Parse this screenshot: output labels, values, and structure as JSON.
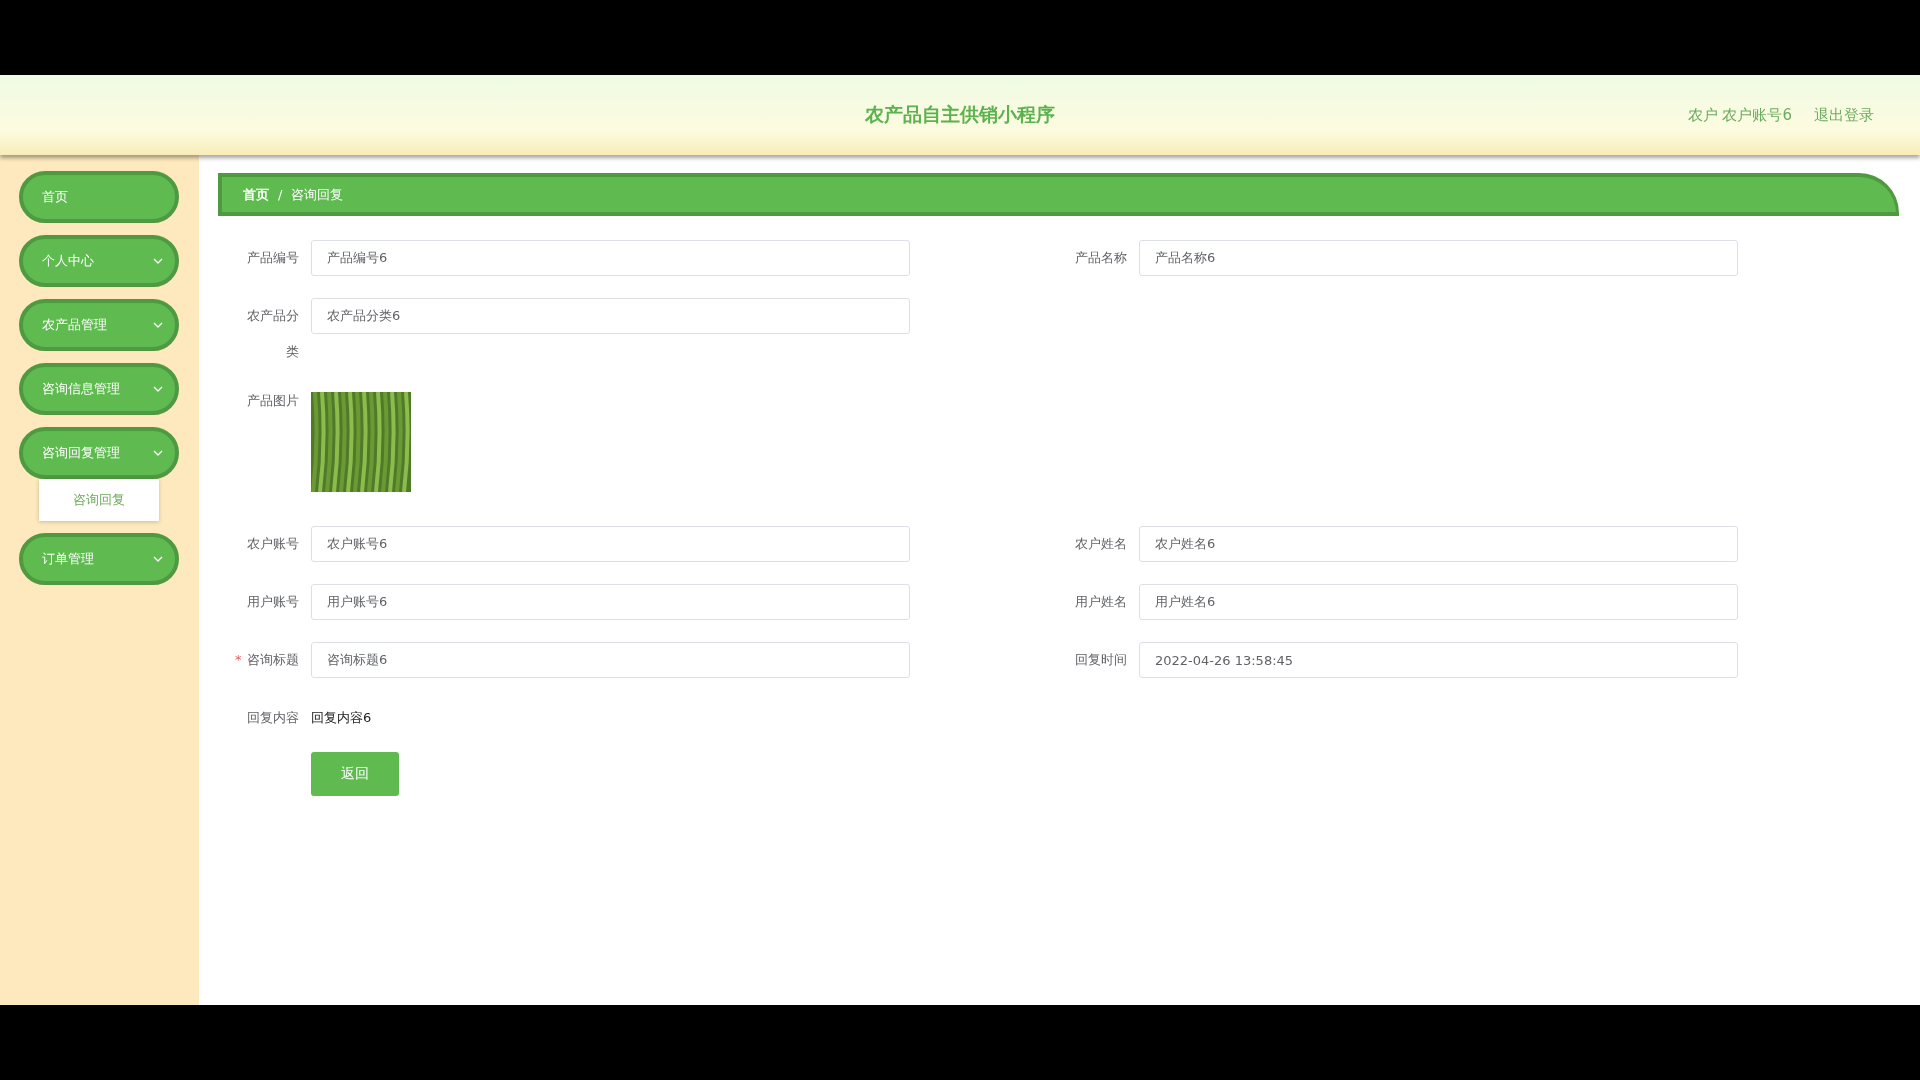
{
  "header": {
    "title": "农产品自主供销小程序",
    "user": "农户 农户账号6",
    "logout": "退出登录"
  },
  "sidebar": {
    "items": [
      {
        "label": "首页",
        "has_submenu": false
      },
      {
        "label": "个人中心",
        "has_submenu": true
      },
      {
        "label": "农产品管理",
        "has_submenu": true
      },
      {
        "label": "咨询信息管理",
        "has_submenu": true
      },
      {
        "label": "咨询回复管理",
        "has_submenu": true,
        "expanded": true,
        "children": [
          {
            "label": "咨询回复"
          }
        ]
      },
      {
        "label": "订单管理",
        "has_submenu": true
      }
    ]
  },
  "breadcrumb": {
    "separator": "/",
    "items": [
      {
        "label": "首页"
      },
      {
        "label": "咨询回复"
      }
    ]
  },
  "form": {
    "rows": [
      [
        {
          "kind": "input",
          "label": "产品编号",
          "value": "产品编号6"
        },
        {
          "kind": "input",
          "label": "产品名称",
          "value": "产品名称6"
        }
      ],
      [
        {
          "kind": "input",
          "label": "农产品分类",
          "value": "农产品分类6"
        }
      ],
      [
        {
          "kind": "image",
          "label": "产品图片"
        }
      ],
      [
        {
          "kind": "input",
          "label": "农户账号",
          "value": "农户账号6"
        },
        {
          "kind": "input",
          "label": "农户姓名",
          "value": "农户姓名6"
        }
      ],
      [
        {
          "kind": "input",
          "label": "用户账号",
          "value": "用户账号6"
        },
        {
          "kind": "input",
          "label": "用户姓名",
          "value": "用户姓名6"
        }
      ],
      [
        {
          "kind": "input",
          "label": "咨询标题",
          "value": "咨询标题6",
          "mark": "*"
        },
        {
          "kind": "input",
          "label": "回复时间",
          "value": "2022-04-26 13:58:45"
        }
      ],
      [
        {
          "kind": "text",
          "label": "回复内容",
          "value": "回复内容6"
        }
      ]
    ],
    "button": "返回"
  }
}
